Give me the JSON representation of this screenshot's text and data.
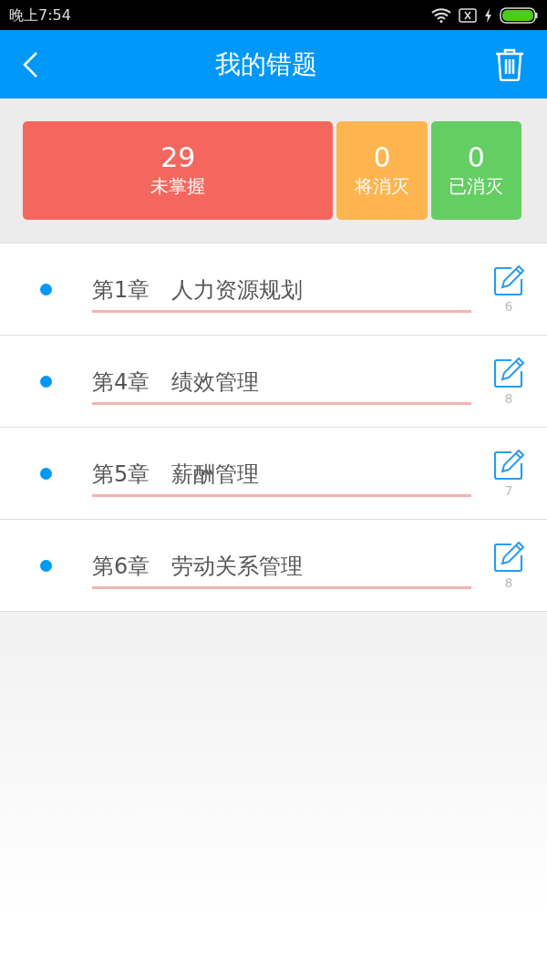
{
  "status_bar": {
    "time": "晚上7:54"
  },
  "header": {
    "title": "我的错题"
  },
  "stats": [
    {
      "count": "29",
      "label": "未掌握",
      "color": "#f5675e"
    },
    {
      "count": "0",
      "label": "将消灭",
      "color": "#ffb54f"
    },
    {
      "count": "0",
      "label": "已消灭",
      "color": "#64cd63"
    }
  ],
  "chapters": [
    {
      "title": "第1章　人力资源规划",
      "count": "6"
    },
    {
      "title": "第4章　绩效管理",
      "count": "8"
    },
    {
      "title": "第5章　薪酬管理",
      "count": "7"
    },
    {
      "title": "第6章　劳动关系管理",
      "count": "8"
    }
  ]
}
